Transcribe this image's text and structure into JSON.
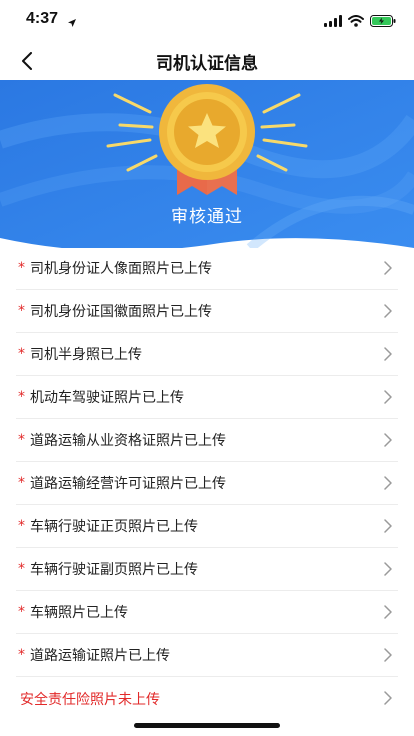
{
  "status_bar": {
    "time": "4:37",
    "icons": [
      "location-arrow-icon",
      "signal-icon",
      "wifi-icon",
      "battery-charging-icon"
    ]
  },
  "nav": {
    "title": "司机认证信息",
    "back_icon": "chevron-left-icon"
  },
  "banner": {
    "status_text": "审核通过",
    "badge_icon": "medal-star-icon",
    "colors": {
      "background": "#2f7fe6",
      "medal": "#f5c542",
      "ribbon": "#e86a4a",
      "rays": "#f7d96a"
    }
  },
  "items": [
    {
      "label": "司机身份证人像面照片已上传",
      "required": "*"
    },
    {
      "label": "司机身份证国徽面照片已上传",
      "required": "*"
    },
    {
      "label": "司机半身照已上传",
      "required": "*"
    },
    {
      "label": "机动车驾驶证照片已上传",
      "required": "*"
    },
    {
      "label": "道路运输从业资格证照片已上传",
      "required": "*"
    },
    {
      "label": "道路运输经营许可证照片已上传",
      "required": "*"
    },
    {
      "label": "车辆行驶证正页照片已上传",
      "required": "*"
    },
    {
      "label": "车辆行驶证副页照片已上传",
      "required": "*"
    },
    {
      "label": "车辆照片已上传",
      "required": "*"
    },
    {
      "label": "道路运输证照片已上传",
      "required": "*"
    },
    {
      "label": "安全责任险照片未上传",
      "required": ""
    }
  ],
  "colors": {
    "required_marker": "#e22a2a",
    "warning_text": "#e22a2a",
    "chevron": "#9a9a9a"
  }
}
